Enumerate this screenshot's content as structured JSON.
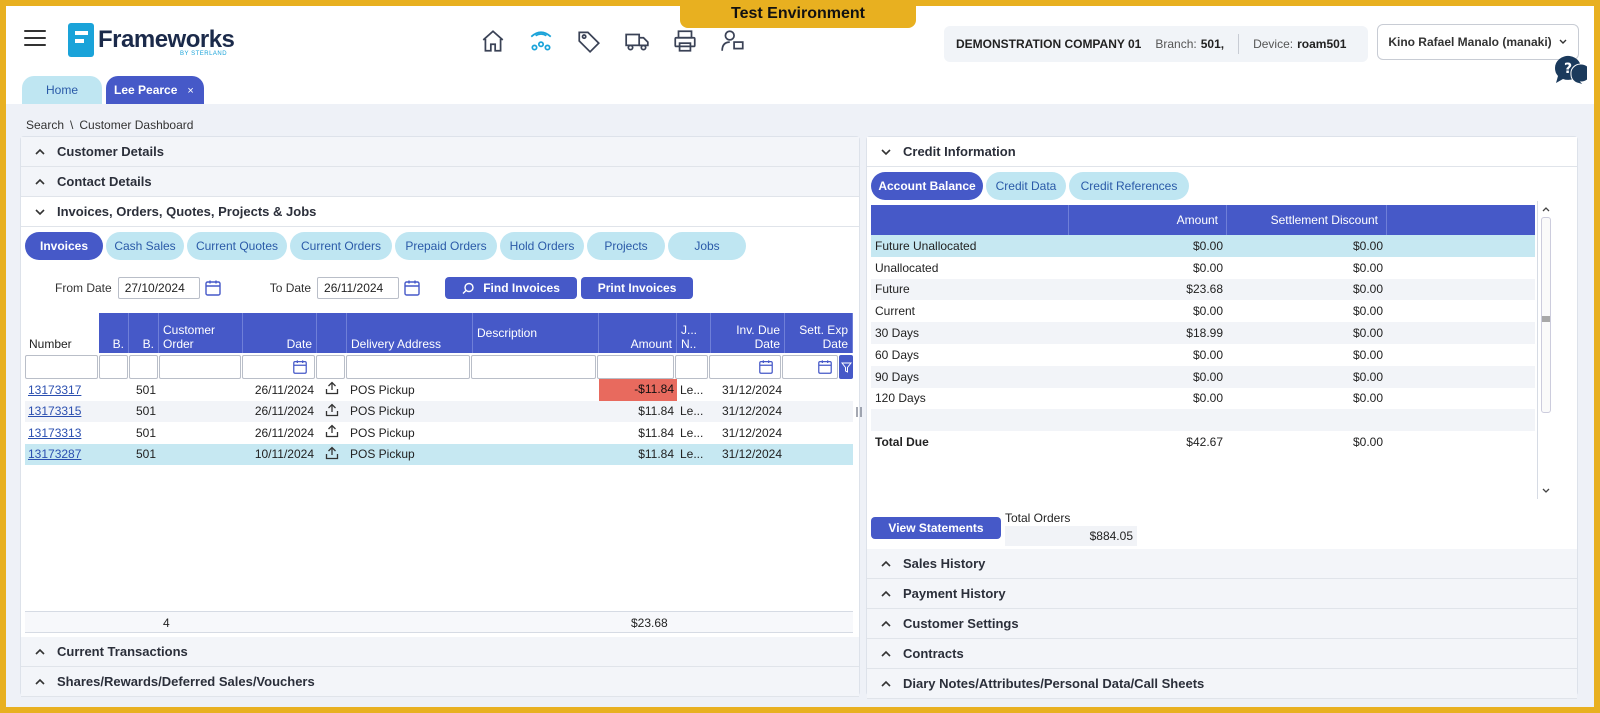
{
  "env_banner": "Test Environment",
  "logo": {
    "name": "Frameworks",
    "sub": "BY STERLAND"
  },
  "company": {
    "name": "DEMONSTRATION COMPANY 01",
    "branch_label": "Branch:",
    "branch_value": "501,",
    "device_label": "Device:",
    "device_value": "roam501"
  },
  "user": {
    "name": "Kino Rafael Manalo (manaki)"
  },
  "tabs": [
    {
      "label": "Home"
    },
    {
      "label": "Lee Pearce",
      "close": "×"
    }
  ],
  "breadcrumb": {
    "a": "Search",
    "sep": "\\",
    "b": "Customer Dashboard"
  },
  "left": {
    "sections_top": [
      "Customer Details",
      "Contact Details",
      "Invoices, Orders, Quotes, Projects & Jobs"
    ],
    "sub_tabs": [
      "Invoices",
      "Cash Sales",
      "Current Quotes",
      "Current Orders",
      "Prepaid Orders",
      "Hold Orders",
      "Projects",
      "Jobs"
    ],
    "filter": {
      "from_label": "From Date",
      "from_value": "27/10/2024",
      "to_label": "To Date",
      "to_value": "26/11/2024",
      "find_label": "Find Invoices",
      "print_label": "Print Invoices"
    },
    "grid_headers": [
      "Number",
      "B.",
      "B.",
      "Customer Order",
      "Date",
      "",
      "Delivery Address",
      "Description",
      "Amount",
      "J... N..",
      "Inv. Due Date",
      "Sett. Exp Date"
    ],
    "rows": [
      {
        "number": "13173317",
        "b": "501",
        "date": "26/11/2024",
        "delivery": "POS Pickup",
        "amount": "-$11.84",
        "j": "Le...",
        "due": "31/12/2024"
      },
      {
        "number": "13173315",
        "b": "501",
        "date": "26/11/2024",
        "delivery": "POS Pickup",
        "amount": "$11.84",
        "j": "Le...",
        "due": "31/12/2024"
      },
      {
        "number": "13173313",
        "b": "501",
        "date": "26/11/2024",
        "delivery": "POS Pickup",
        "amount": "$11.84",
        "j": "Le...",
        "due": "31/12/2024"
      },
      {
        "number": "13173287",
        "b": "501",
        "date": "10/11/2024",
        "delivery": "POS Pickup",
        "amount": "$11.84",
        "j": "Le...",
        "due": "31/12/2024"
      }
    ],
    "footer": {
      "count": "4",
      "total": "$23.68"
    },
    "sections_bottom": [
      "Current Transactions",
      "Shares/Rewards/Deferred Sales/Vouchers"
    ]
  },
  "right": {
    "section_title": "Credit Information",
    "sub_tabs": [
      "Account Balance",
      "Credit Data",
      "Credit References"
    ],
    "grid_headers": [
      "",
      "Amount",
      "Settlement Discount"
    ],
    "rows": [
      {
        "label": "Future Unallocated",
        "amount": "$0.00",
        "disc": "$0.00"
      },
      {
        "label": "Unallocated",
        "amount": "$0.00",
        "disc": "$0.00"
      },
      {
        "label": "Future",
        "amount": "$23.68",
        "disc": "$0.00"
      },
      {
        "label": "Current",
        "amount": "$0.00",
        "disc": "$0.00"
      },
      {
        "label": "30 Days",
        "amount": "$18.99",
        "disc": "$0.00"
      },
      {
        "label": "60 Days",
        "amount": "$0.00",
        "disc": "$0.00"
      },
      {
        "label": "90 Days",
        "amount": "$0.00",
        "disc": "$0.00"
      },
      {
        "label": "120 Days",
        "amount": "$0.00",
        "disc": "$0.00"
      }
    ],
    "total": {
      "label": "Total Due",
      "amount": "$42.67",
      "disc": "$0.00"
    },
    "view_statements": "View Statements",
    "total_orders_label": "Total Orders",
    "total_orders_value": "$884.05",
    "sections_bottom": [
      "Sales History",
      "Payment History",
      "Customer Settings",
      "Contracts",
      "Diary Notes/Attributes/Personal Data/Call Sheets"
    ]
  },
  "colors": {
    "accent": "#4659c8",
    "tab_inactive": "#bfe6f2",
    "banner": "#e8b020",
    "negative": "#e86a5e"
  }
}
